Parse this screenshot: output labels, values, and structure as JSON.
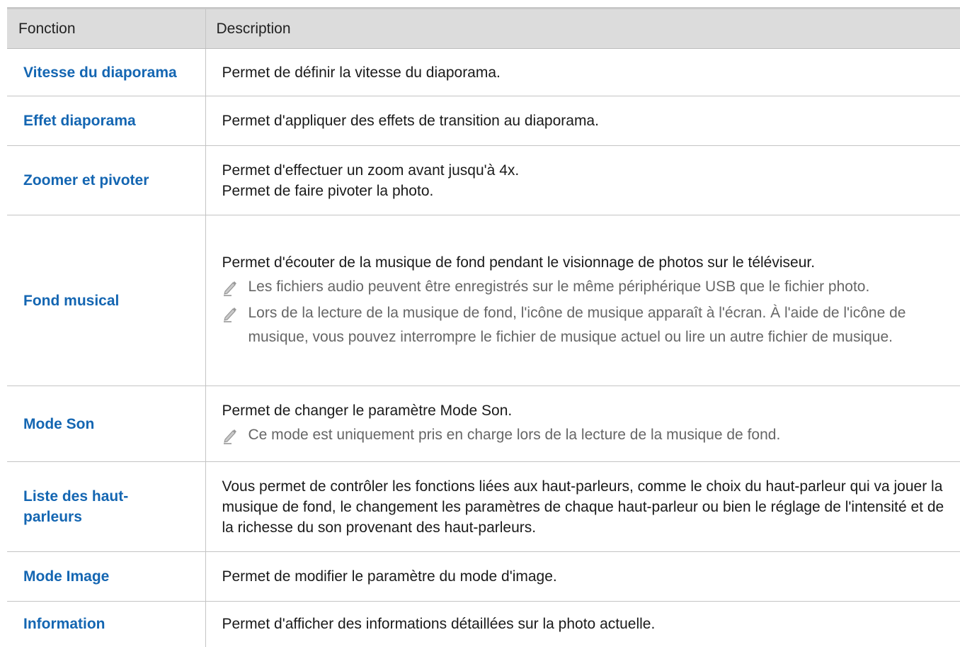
{
  "table": {
    "headers": {
      "function": "Fonction",
      "description": "Description"
    },
    "rows": [
      {
        "function": "Vitesse du diaporama",
        "lines": [
          "Permet de définir la vitesse du diaporama."
        ],
        "notes": []
      },
      {
        "function": "Effet diaporama",
        "lines": [
          "Permet d'appliquer des effets de transition au diaporama."
        ],
        "notes": []
      },
      {
        "function": "Zoomer et pivoter",
        "lines": [
          "Permet d'effectuer un zoom avant jusqu'à 4x.",
          "Permet de faire pivoter la photo."
        ],
        "notes": []
      },
      {
        "function": "Fond musical",
        "lines": [
          "Permet d'écouter de la musique de fond pendant le visionnage de photos sur le téléviseur."
        ],
        "notes": [
          "Les fichiers audio peuvent être enregistrés sur le même périphérique USB que le fichier photo.",
          "Lors de la lecture de la musique de fond, l'icône de musique apparaît à l'écran. À l'aide de l'icône de musique, vous pouvez interrompre le fichier de musique actuel ou lire un autre fichier de musique."
        ]
      },
      {
        "function": "Mode Son",
        "lines": [
          "Permet de changer le paramètre Mode Son."
        ],
        "notes": [
          "Ce mode est uniquement pris en charge lors de la lecture de la musique de fond."
        ]
      },
      {
        "function": "Liste des haut-parleurs",
        "lines": [
          "Vous permet de contrôler les fonctions liées aux haut-parleurs, comme le choix du haut-parleur qui va jouer la musique de fond, le changement les paramètres de chaque haut-parleur ou bien le réglage de l'intensité et de la richesse du son provenant des haut-parleurs."
        ],
        "notes": []
      },
      {
        "function": "Mode Image",
        "lines": [
          "Permet de modifier le paramètre du mode d'image."
        ],
        "notes": []
      },
      {
        "function": "Information",
        "lines": [
          "Permet d'afficher des informations détaillées sur la photo actuelle."
        ],
        "notes": []
      }
    ]
  },
  "icons": {
    "note": "pencil-icon"
  },
  "colors": {
    "header_background": "#dcdcdc",
    "function_text": "#1466b2",
    "note_text": "#666666",
    "grid_line": "#c4c4c4"
  }
}
